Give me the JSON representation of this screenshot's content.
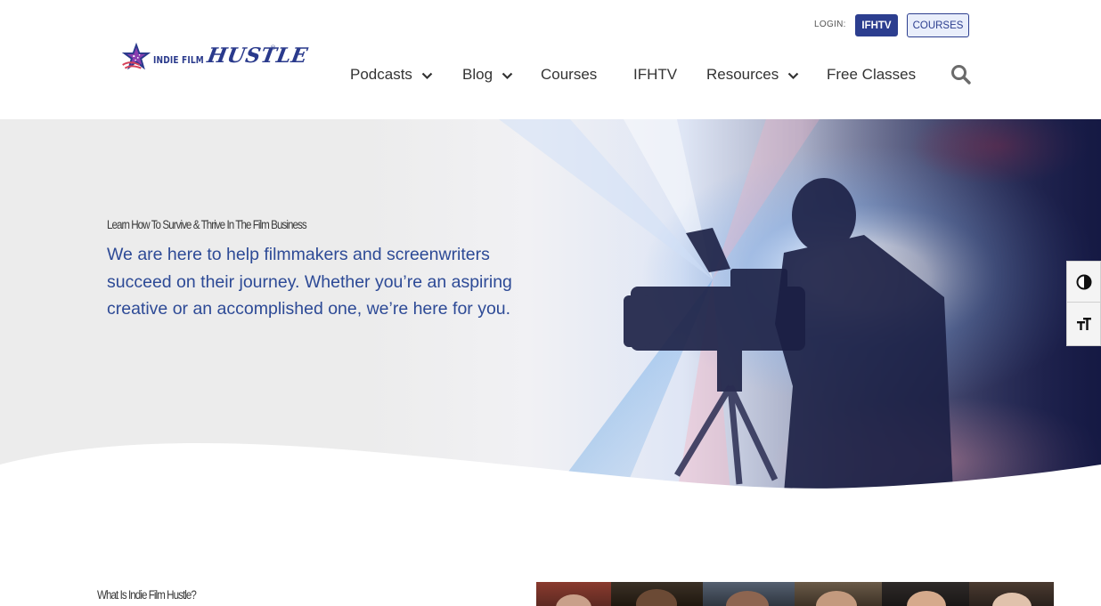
{
  "brand": {
    "logo_small": "INDIE FILM",
    "logo_script": "HUSTLE",
    "logo_mark": "®"
  },
  "header": {
    "login_label": "LOGIN:",
    "ifhtv_button": "IFHTV",
    "courses_button": "COURSES"
  },
  "nav": {
    "items": [
      {
        "label": "Podcasts",
        "has_dropdown": true
      },
      {
        "label": "Blog",
        "has_dropdown": true
      },
      {
        "label": "Courses",
        "has_dropdown": false
      },
      {
        "label": "IFHTV",
        "has_dropdown": false
      },
      {
        "label": "Resources",
        "has_dropdown": true
      },
      {
        "label": "Free Classes",
        "has_dropdown": false
      }
    ],
    "search_icon": "search-icon"
  },
  "hero": {
    "eyebrow": "Learn How To Survive & Thrive In The Film Business",
    "text": "We are here to help filmmakers and screenwriters succeed on their journey. Whether you’re an aspiring creative or an accomplished one, we’re here for you."
  },
  "accessibility": {
    "contrast_icon": "contrast-icon",
    "text_size_icon": "text-size-icon"
  },
  "about": {
    "eyebrow": "What Is Indie Film Hustle?"
  },
  "colors": {
    "brand_blue": "#2c3e8f",
    "hero_text": "#2d4a96",
    "nav_text": "#333333"
  }
}
